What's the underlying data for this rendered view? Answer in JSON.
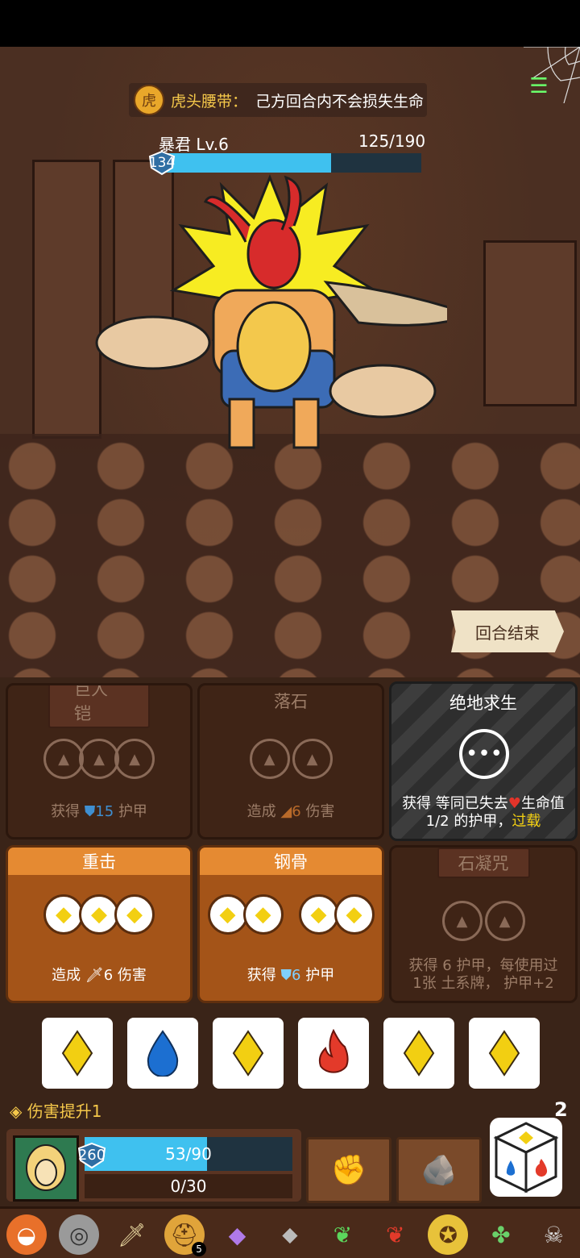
{
  "buff": {
    "icon": "tiger-belt-icon",
    "name": "虎头腰带：",
    "description": "己方回合内不会损失生命"
  },
  "enemy": {
    "name": "暴君 Lv.6",
    "hp_text": "125/190",
    "hp_fraction": 0.6579,
    "shield": "134"
  },
  "end_turn_label": "回合结束",
  "cards": [
    {
      "title": "巨人铠",
      "desc_parts": [
        "获得",
        "15",
        "护甲"
      ],
      "slot_count": 3,
      "state": "disabled"
    },
    {
      "title": "落石",
      "desc_parts": [
        "造成",
        "6",
        "伤害"
      ],
      "slot_count": 2,
      "state": "disabled"
    },
    {
      "title": "绝地求生",
      "desc_line1": "获得 等同已失去",
      "desc_heart": "生命值",
      "desc_line2": "1/2 的护甲，",
      "desc_highlight": "过载",
      "state": "special"
    },
    {
      "title": "重击",
      "desc_parts": [
        "造成",
        "6",
        "伤害"
      ],
      "slot_count": 3,
      "state": "active"
    },
    {
      "title": "钢骨",
      "desc_parts": [
        "获得",
        "6",
        "护甲"
      ],
      "slot_count": 2,
      "state": "active"
    },
    {
      "title": "石凝咒",
      "desc_line1": "获得 6 护甲，每使用过",
      "desc_line2": "1张 土系牌， 护甲+2",
      "slot_count": 2,
      "state": "disabled"
    }
  ],
  "dice": [
    {
      "type": "lightning",
      "icon": "yellow-diamond-icon",
      "color": "#f2cf12"
    },
    {
      "type": "water",
      "icon": "blue-drop-icon",
      "color": "#1c6fd1"
    },
    {
      "type": "lightning",
      "icon": "yellow-diamond-icon",
      "color": "#f2cf12"
    },
    {
      "type": "fire",
      "icon": "red-flame-icon",
      "color": "#e33a2a"
    },
    {
      "type": "lightning",
      "icon": "yellow-diamond-icon",
      "color": "#f2cf12"
    },
    {
      "type": "lightning",
      "icon": "yellow-diamond-icon",
      "color": "#f2cf12"
    }
  ],
  "damage_boost": "伤害提升1",
  "dice_remaining": "2",
  "player": {
    "shield": "260",
    "hp_text": "53/90",
    "hp_fraction": 0.5889,
    "xp_text": "0/30"
  },
  "relics": [
    {
      "name": "stone-relic-icon"
    },
    {
      "name": "spiral-relic-icon"
    },
    {
      "name": "dagger-relic-icon"
    },
    {
      "name": "helmet-relic-icon",
      "badge": "5"
    },
    {
      "name": "crystal-relic-icon"
    },
    {
      "name": "diamond-relic-icon"
    },
    {
      "name": "green-feather-icon"
    },
    {
      "name": "red-feather-icon"
    },
    {
      "name": "gold-ring-icon"
    },
    {
      "name": "clover-icon"
    },
    {
      "name": "scroll-skull-icon"
    }
  ]
}
